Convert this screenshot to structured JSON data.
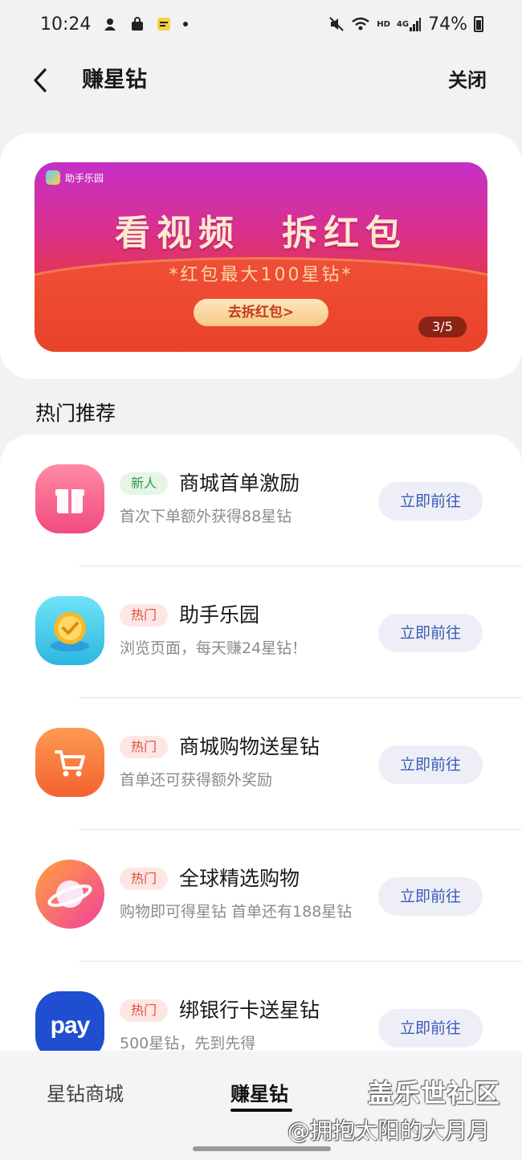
{
  "status_bar": {
    "time": "10:24",
    "network": "HD",
    "signal_label": "4G",
    "battery": "74%"
  },
  "header": {
    "title": "赚星钻",
    "close_label": "关闭"
  },
  "banner": {
    "brand": "助手乐园",
    "title": "看视频　拆红包",
    "subtitle": "*红包最大100星钻*",
    "cta": "去拆红包>",
    "indicator": "3/5"
  },
  "section": {
    "title": "热门推荐"
  },
  "items": [
    {
      "tag": "新人",
      "tag_type": "new",
      "title": "商城首单激励",
      "desc": "首次下单额外获得88星钻",
      "button": "立即前往",
      "icon": "gift-icon",
      "icon_color": "#f45b86"
    },
    {
      "tag": "热门",
      "tag_type": "hot",
      "title": "助手乐园",
      "desc": "浏览页面，每天赚24星钻！",
      "button": "立即前往",
      "icon": "coin-check-icon",
      "icon_color": "#3cc8e8"
    },
    {
      "tag": "热门",
      "tag_type": "hot",
      "title": "商城购物送星钻",
      "desc": "首单还可获得额外奖励",
      "button": "立即前往",
      "icon": "cart-icon",
      "icon_color": "#f6783f"
    },
    {
      "tag": "热门",
      "tag_type": "hot",
      "title": "全球精选购物",
      "desc": "购物即可得星钻 首单还有188星钻",
      "button": "立即前往",
      "icon": "planet-icon",
      "icon_color": "#f05aa2"
    },
    {
      "tag": "热门",
      "tag_type": "hot",
      "title": "绑银行卡送星钻",
      "desc": "500星钻，先到先得",
      "button": "立即前往",
      "icon": "pay-icon",
      "icon_color": "#1f4fd0",
      "icon_text": "pay"
    }
  ],
  "tabs": {
    "store": "星钻商城",
    "earn": "赚星钻"
  },
  "watermark": {
    "title": "盖乐世社区",
    "user": "@拥抱太阳的大月月"
  }
}
